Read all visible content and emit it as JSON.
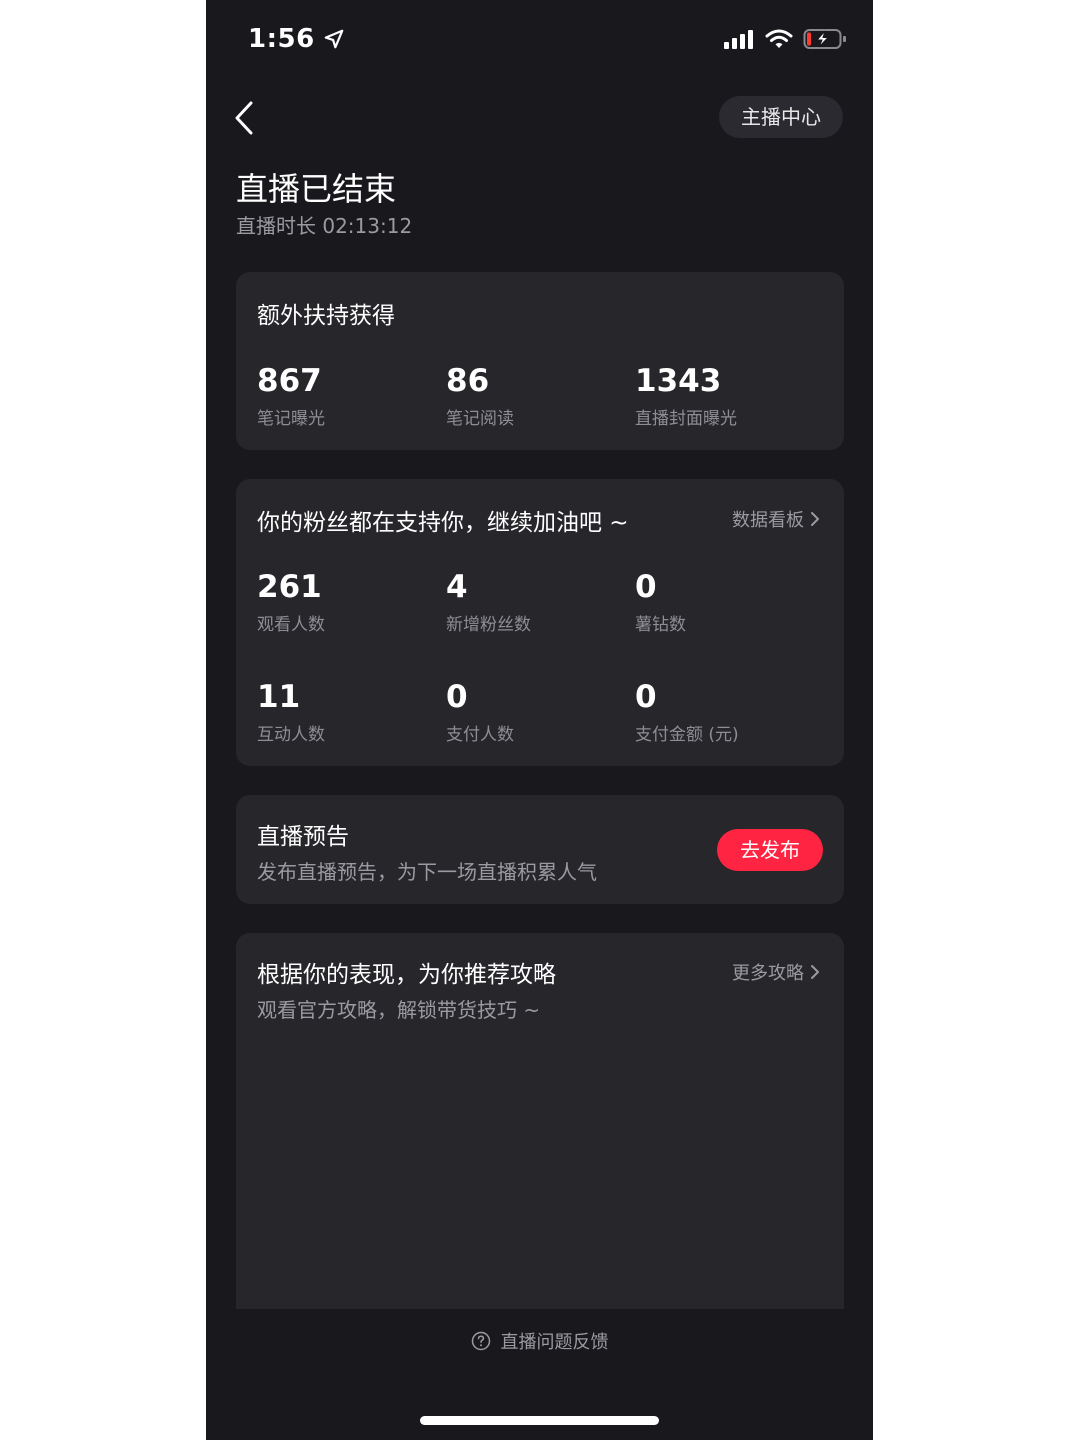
{
  "status_bar": {
    "time": "1:56"
  },
  "header": {
    "anchor_center_label": "主播中心",
    "title": "直播已结束",
    "duration_label": "直播时长",
    "duration_value": "02:13:12"
  },
  "boost_card": {
    "title": "额外扶持获得",
    "stats": [
      {
        "value": "867",
        "label": "笔记曝光"
      },
      {
        "value": "86",
        "label": "笔记阅读"
      },
      {
        "value": "1343",
        "label": "直播封面曝光"
      }
    ]
  },
  "fans_card": {
    "title": "你的粉丝都在支持你，继续加油吧 ~",
    "link_label": "数据看板",
    "stats": [
      {
        "value": "261",
        "label": "观看人数"
      },
      {
        "value": "4",
        "label": "新增粉丝数"
      },
      {
        "value": "0",
        "label": "薯钻数"
      },
      {
        "value": "11",
        "label": "互动人数"
      },
      {
        "value": "0",
        "label": "支付人数"
      },
      {
        "value": "0",
        "label": "支付金额 (元)"
      }
    ]
  },
  "preview_card": {
    "title": "直播预告",
    "subtitle": "发布直播预告，为下一场直播积累人气",
    "button_label": "去发布"
  },
  "strategy_card": {
    "title": "根据你的表现，为你推荐攻略",
    "subtitle": "观看官方攻略，解锁带货技巧 ~",
    "link_label": "更多攻略"
  },
  "footer": {
    "feedback_label": "直播问题反馈"
  },
  "colors": {
    "accent": "#ff2442",
    "background": "#19191d",
    "card": "#26262b"
  }
}
